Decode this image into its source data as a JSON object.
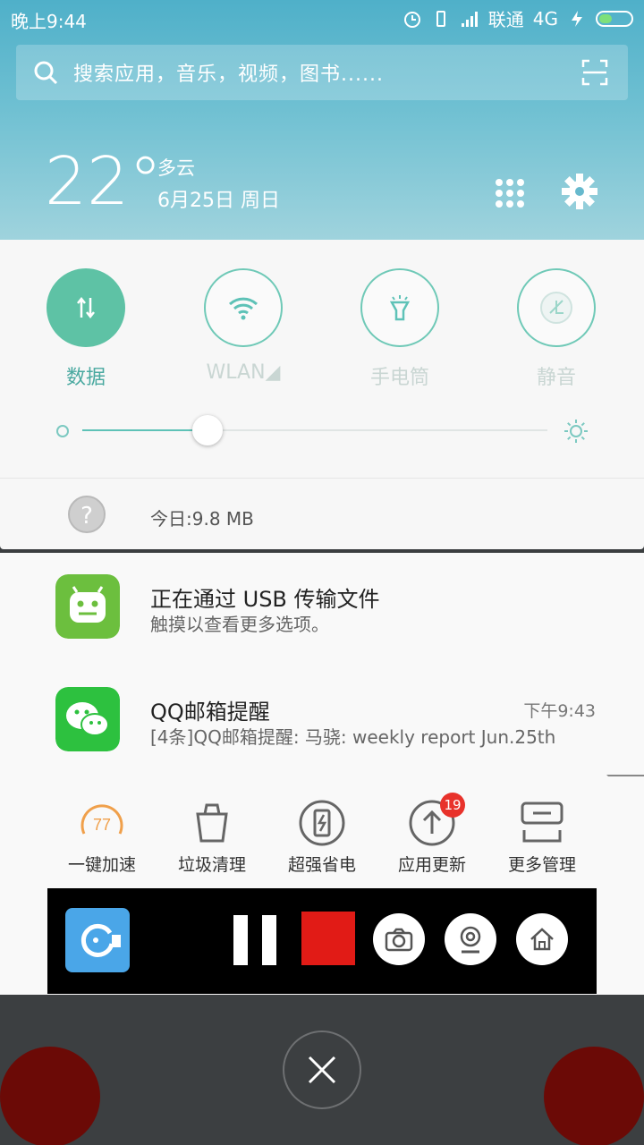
{
  "statusbar": {
    "time": "晚上9:44",
    "carrier": "联通",
    "network": "4G"
  },
  "search": {
    "placeholder": "搜索应用，音乐，视频，图书......"
  },
  "weather": {
    "temperature": "22°",
    "condition": "多云",
    "date": "6月25日 周日"
  },
  "quick_settings": {
    "toggles": [
      {
        "label": "数据",
        "state": "on"
      },
      {
        "label": "WLAN◢",
        "state": "off"
      },
      {
        "label": "手电筒",
        "state": "off"
      },
      {
        "label": "静音",
        "state": "off"
      }
    ],
    "brightness": 0.27,
    "data_usage": "今日:9.8 MB",
    "data_icon": "?"
  },
  "notifications": [
    {
      "app": "usb",
      "title": "正在通过 USB 传输文件",
      "subtitle": "触摸以查看更多选项。",
      "time": ""
    },
    {
      "app": "wechat",
      "title": "QQ邮箱提醒",
      "subtitle": "[4条]QQ邮箱提醒: 马骁: weekly report Jun.25th",
      "time": "下午9:43"
    }
  ],
  "tools": [
    {
      "label": "一键加速",
      "icon": "speed-gauge-icon",
      "value": "77"
    },
    {
      "label": "垃圾清理",
      "icon": "trash-clean-icon"
    },
    {
      "label": "超强省电",
      "icon": "battery-saver-icon"
    },
    {
      "label": "应用更新",
      "icon": "update-arrow-icon",
      "badge": "19"
    },
    {
      "label": "更多管理",
      "icon": "more-manage-icon"
    }
  ],
  "colors": {
    "accent": "#5ec2a5",
    "header": "#4fb0c9",
    "badge": "#e8322b",
    "record_stop": "#e11b16"
  }
}
